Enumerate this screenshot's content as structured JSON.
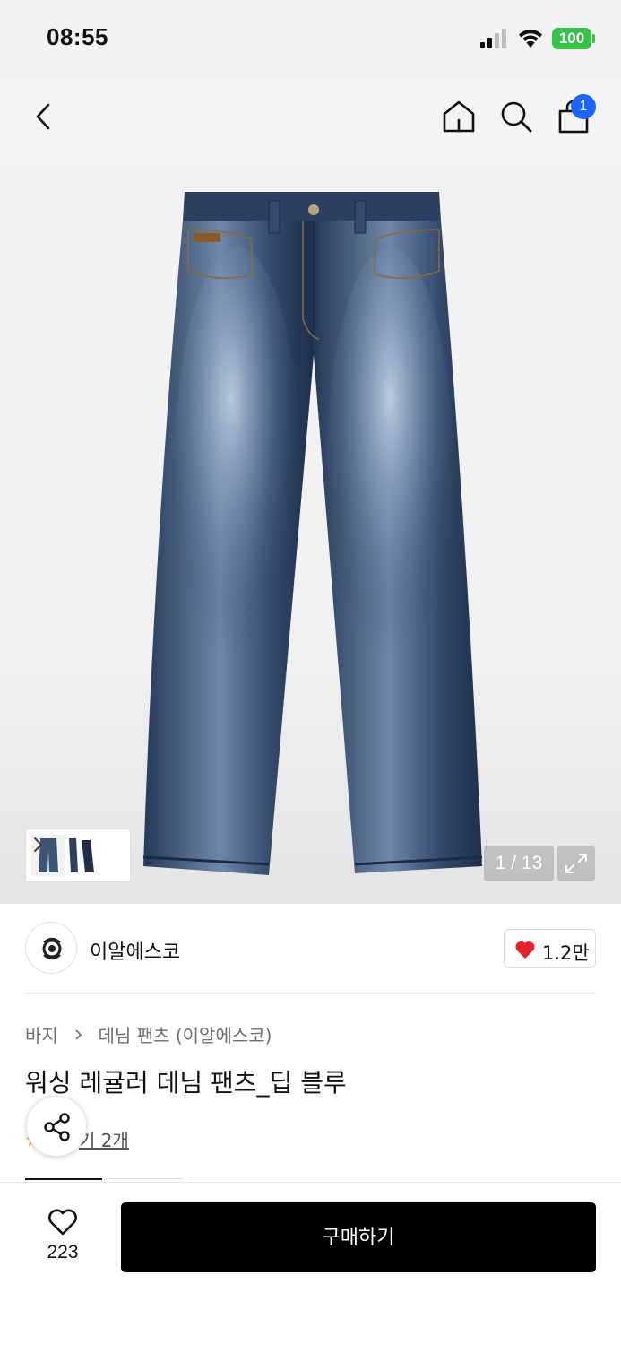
{
  "status_bar": {
    "time": "08:55",
    "battery": "100"
  },
  "header": {
    "back_icon": "chevron-left-icon",
    "home_icon": "home-icon",
    "search_icon": "search-icon",
    "cart_icon": "shopping-bag-icon",
    "cart_badge": "1"
  },
  "gallery": {
    "pager": "1 / 13",
    "expand_icon": "expand-icon"
  },
  "brand": {
    "name": "이알에스코",
    "like_count": "1.2만"
  },
  "product": {
    "breadcrumb": [
      "바지",
      "데님 팬츠 (이알에스코)"
    ],
    "title": "워싱 레귤러 데님 팬츠_딥 블루",
    "review_text": "후기 2개",
    "review_visible_text": "기 2개"
  },
  "bottom": {
    "wish_count": "223",
    "buy_label": "구매하기"
  },
  "colors": {
    "accent_blue": "#1b64ff",
    "battery_green": "#37c24a",
    "heart_red": "#e8202a",
    "buy_button": "#000000"
  }
}
